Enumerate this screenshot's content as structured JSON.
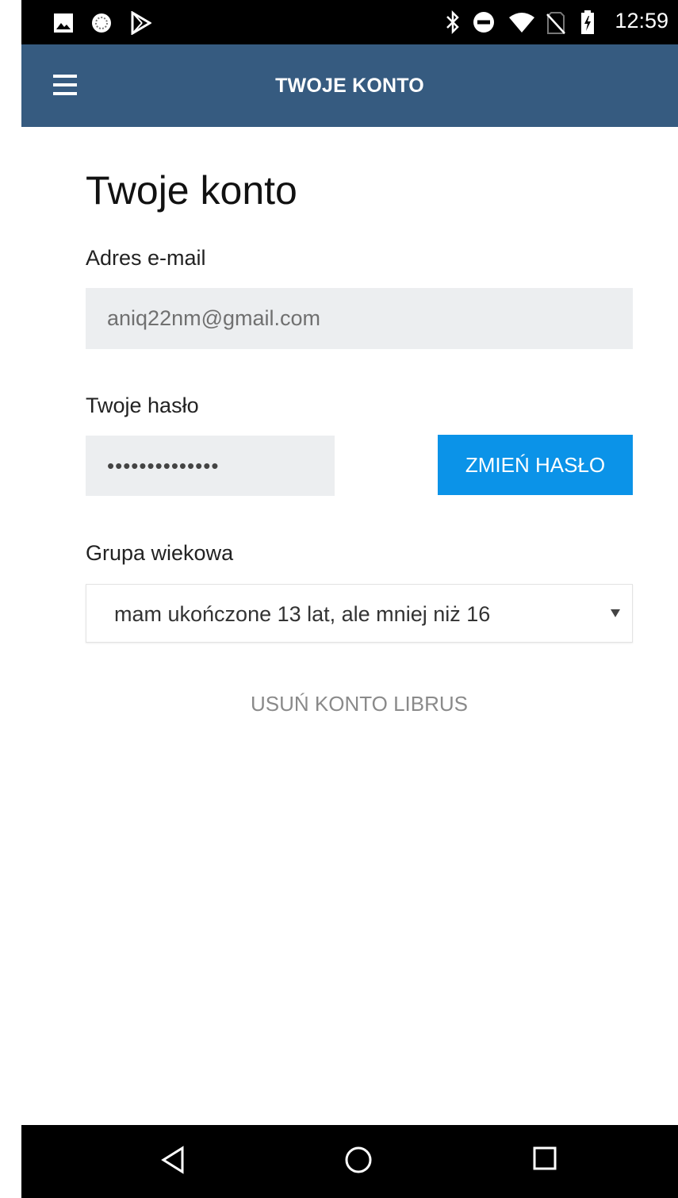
{
  "status_bar": {
    "time": "12:59",
    "left_icons": [
      "image-icon",
      "sync-icon",
      "play-store-icon"
    ],
    "right_icons": [
      "bluetooth-icon",
      "do-not-disturb-icon",
      "wifi-icon",
      "no-sim-icon",
      "battery-charging-icon"
    ]
  },
  "app_bar": {
    "title": "TWOJE KONTO",
    "menu_icon": "hamburger-menu-icon",
    "background": "#365b80"
  },
  "page": {
    "title": "Twoje konto",
    "email": {
      "label": "Adres e-mail",
      "value": "aniq22nm@gmail.com"
    },
    "password": {
      "label": "Twoje hasło",
      "value": "••••••••••••••",
      "change_button": "ZMIEŃ HASŁO"
    },
    "age_group": {
      "label": "Grupa wiekowa",
      "selected": "mam ukończone 13 lat, ale mniej niż 16"
    },
    "delete_link": "USUŃ KONTO LIBRUS"
  },
  "colors": {
    "accent": "#0b93e8",
    "field_bg": "#eceef0"
  },
  "nav_bar": {
    "buttons": [
      "back-icon",
      "home-icon",
      "recents-icon"
    ]
  }
}
